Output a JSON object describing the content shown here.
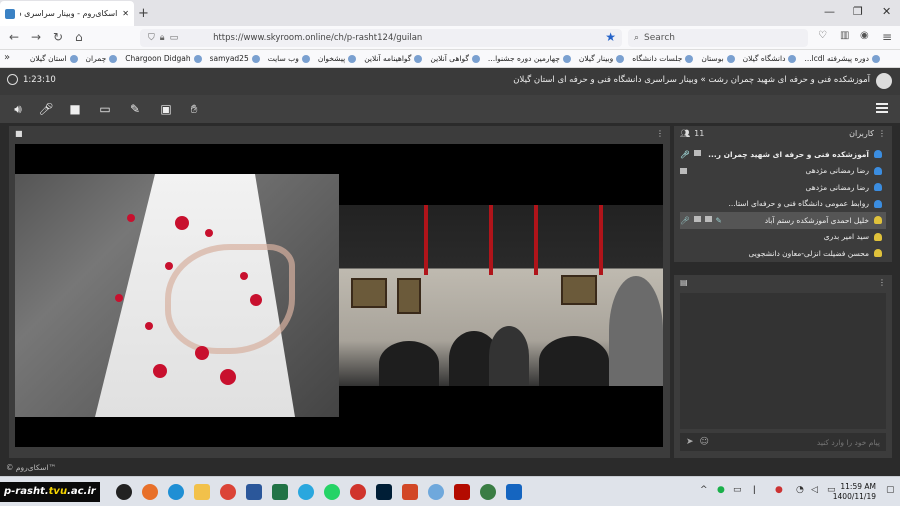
{
  "browser": {
    "tab_title": "اسکای‌روم - وبینار سراسری دانش...",
    "new_tab": "+",
    "window_controls": [
      "—",
      "❐",
      "✕"
    ],
    "url": "https://www.skyroom.online/ch/p-rasht124/guilan",
    "search_placeholder": "Search",
    "bookmarks_overflow": "»",
    "bookmarks": [
      "دوره پیشرفته lcdl...",
      "دانشگاه گیلان",
      "بوستان",
      "جلسات دانشگاه",
      "وبینار گیلان",
      "چهارمین دوره جشنوا...",
      "گواهی آنلاین",
      "گواهینامه آنلاین",
      "پیشخوان",
      "وب سایت",
      "samyad25",
      "Chargoon Didgah",
      "چمران",
      "استان گیلان"
    ]
  },
  "app": {
    "title": "آموزشکده فنی و حرفه ای شهید چمران رشت » وبینار سراسری دانشگاه فنی و حرفه ای استان گیلان",
    "timer": "1:23:10",
    "footer": "© اسکای‌روم™"
  },
  "users_panel": {
    "title": "کاربران",
    "count": "11",
    "users": [
      {
        "name": "آموزشکده فنی و حرفه ای شهید چمران ر...",
        "type": "blue",
        "bold": true
      },
      {
        "name": "رضا رمضانی مژدهی",
        "type": "blue"
      },
      {
        "name": "رضا رمضانی مژدهی",
        "type": "blue"
      },
      {
        "name": "روابط عمومی دانشگاه فنی و حرفه‌ای استا...",
        "type": "blue"
      },
      {
        "name": "خلیل احمدی آموزشکده رستم آباد",
        "type": "gold",
        "selected": true
      },
      {
        "name": "سید امیر بدری",
        "type": "gold"
      },
      {
        "name": "محسن فضیلت انزلی-معاون دانشجویی",
        "type": "gold"
      }
    ]
  },
  "chat_panel": {
    "placeholder": "پیام خود را وارد کنید"
  },
  "taskbar": {
    "brand_prefix": "p-rasht.",
    "brand_mid": "tvu",
    "brand_suffix": ".ac.ir",
    "time": "11:59 AM",
    "date": "1400/11/19"
  },
  "colors": {
    "app_bg": "#2b2b2b",
    "panel_bg": "#3c3c3c",
    "user_blue": "#3b8de0",
    "user_gold": "#e0c23b",
    "rose_red": "#c8102e"
  }
}
